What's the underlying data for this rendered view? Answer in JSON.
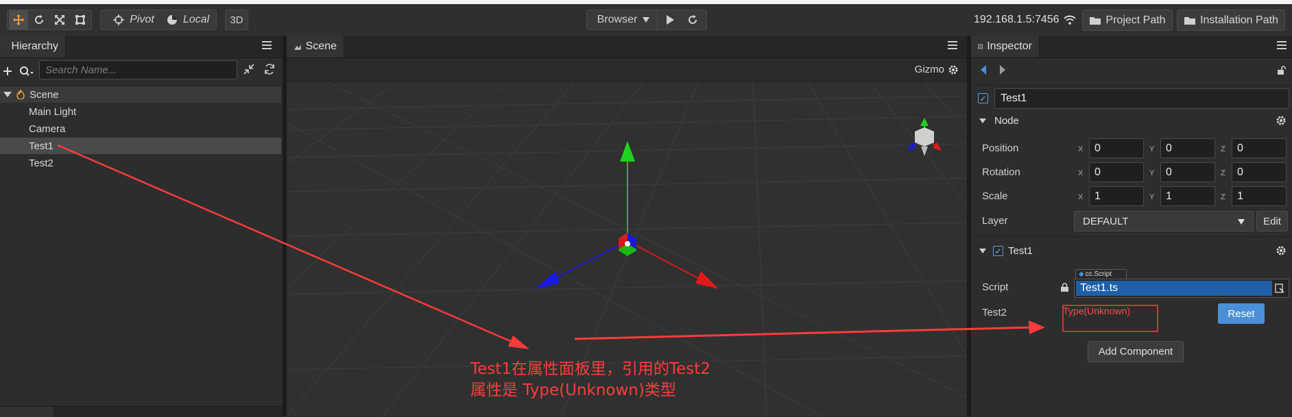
{
  "toolbar": {
    "pivot_label": "Pivot",
    "local_label": "Local",
    "mode_3d_label": "3D",
    "browser_label": "Browser",
    "ip_address": "192.168.1.5:7456",
    "project_path_label": "Project Path",
    "installation_path_label": "Installation Path"
  },
  "hierarchy": {
    "tab_label": "Hierarchy",
    "search_placeholder": "Search Name...",
    "root": "Scene",
    "items": [
      {
        "label": "Main Light"
      },
      {
        "label": "Camera"
      },
      {
        "label": "Test1"
      },
      {
        "label": "Test2"
      }
    ]
  },
  "scene": {
    "tab_label": "Scene",
    "gizmo_label": "Gizmo"
  },
  "annotation": {
    "line1": "Test1在属性面板里，引用的Test2",
    "line2": "属性是 Type(Unknown)类型"
  },
  "inspector": {
    "tab_label": "Inspector",
    "node_name": "Test1",
    "node_section": "Node",
    "position": {
      "label": "Position",
      "x": "0",
      "y": "0",
      "z": "0"
    },
    "rotation": {
      "label": "Rotation",
      "x": "0",
      "y": "0",
      "z": "0"
    },
    "scale": {
      "label": "Scale",
      "x": "1",
      "y": "1",
      "z": "1"
    },
    "axis_x": "X",
    "axis_y": "Y",
    "axis_z": "Z",
    "layer": {
      "label": "Layer",
      "value": "DEFAULT",
      "edit_label": "Edit"
    },
    "component": {
      "title": "Test1",
      "script_label": "Script",
      "script_badge": "cc.Script",
      "script_value": "Test1.ts",
      "test2_label": "Test2",
      "test2_value": "Type(Unknown)",
      "reset_label": "Reset"
    },
    "add_component_label": "Add Component"
  },
  "colors": {
    "accent_blue": "#1f5fa8",
    "reset_blue": "#4a90d9",
    "annotation_red": "#ff3b3b"
  }
}
